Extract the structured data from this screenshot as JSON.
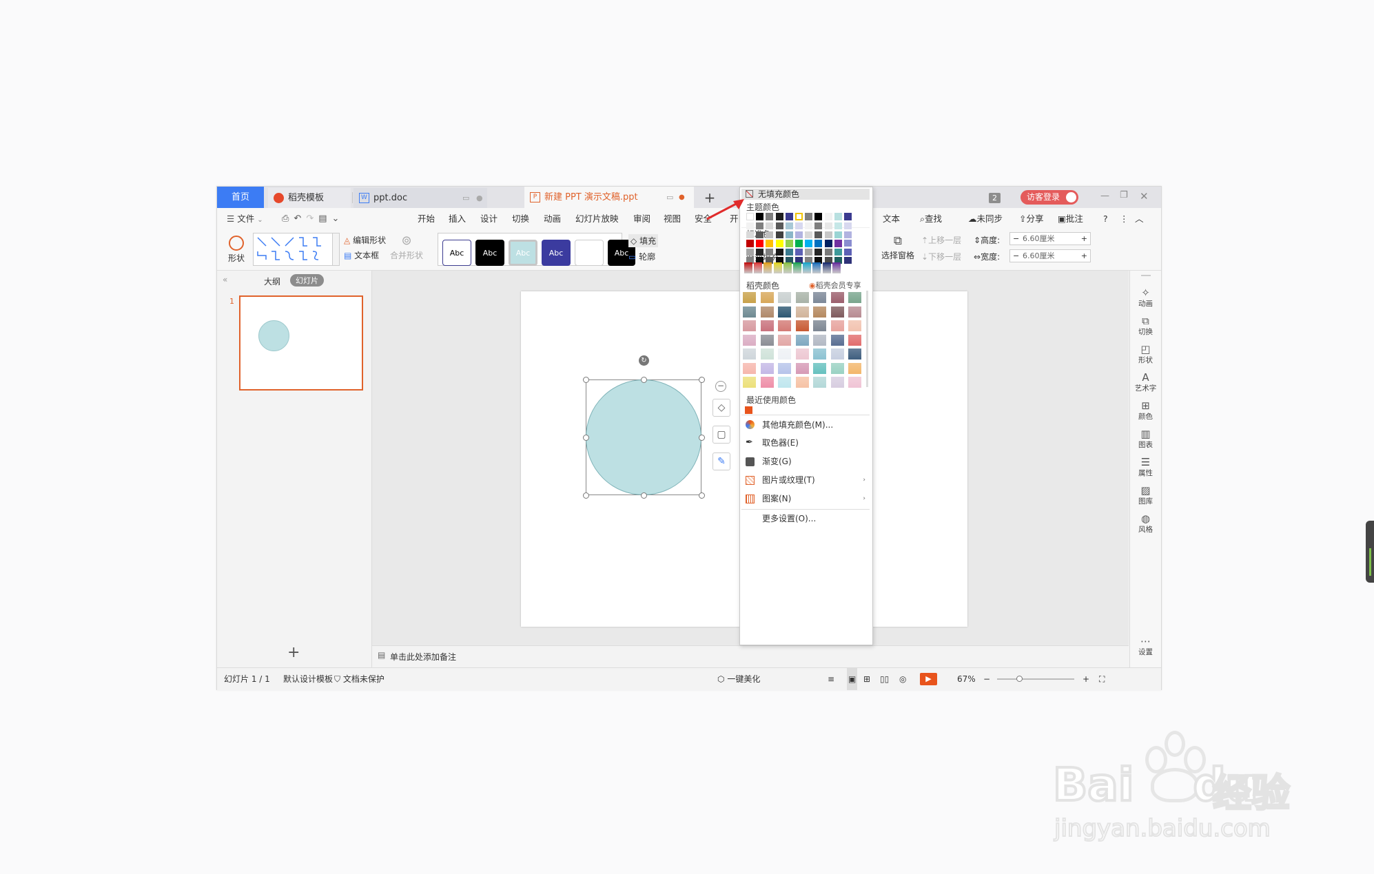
{
  "tabs": {
    "home": "首页",
    "template": "稻壳模板",
    "doc": "ppt.doc",
    "ppt": "新建 PPT 演示文稿.ppt",
    "add": "+"
  },
  "title_right": {
    "page_count": "2",
    "login": "访客登录"
  },
  "menu": {
    "file": "文件",
    "items": [
      "开始",
      "插入",
      "设计",
      "切换",
      "动画",
      "幻灯片放映",
      "审阅",
      "视图",
      "安全",
      "开"
    ],
    "text_tool": "文本",
    "find": "查找",
    "sync": "未同步",
    "share": "分享",
    "annotate": "批注",
    "help": "?"
  },
  "ribbon": {
    "shape": "形状",
    "edit_shape": "编辑形状",
    "textbox": "文本框",
    "merge_shape": "合并形状",
    "style_label": "Abc",
    "fill": "填充",
    "outline": "轮廓",
    "selection_pane": "选择窗格",
    "move_up": "上移一层",
    "move_down": "下移一层",
    "height_label": "高度:",
    "width_label": "宽度:",
    "height_value": "6.60厘米",
    "width_value": "6.60厘米"
  },
  "left_panel": {
    "outline_tab": "大纲",
    "slides_tab": "幻灯片",
    "slide_number": "1",
    "add": "+"
  },
  "notes_placeholder": "单击此处添加备注",
  "right_bar": [
    "动画",
    "切换",
    "形状",
    "艺术字",
    "颜色",
    "图表",
    "属性",
    "图库",
    "风格",
    "设置"
  ],
  "status": {
    "slide_info": "幻灯片 1 / 1",
    "template": "默认设计模板",
    "protection": "文档未保护",
    "beautify": "一键美化",
    "zoom": "67%"
  },
  "dropdown": {
    "no_fill": "无填充颜色",
    "theme_colors": "主题颜色",
    "standard_colors": "标准色",
    "gradient_fill": "渐变填充",
    "docer_colors": "稻壳颜色",
    "member_only": "稻壳会员专享",
    "recent_colors": "最近使用颜色",
    "more_fill": "其他填充颜色(M)...",
    "eyedropper": "取色器(E)",
    "gradient": "渐变(G)",
    "picture_texture": "图片或纹理(T)",
    "pattern": "图案(N)",
    "more_settings": "更多设置(O)...",
    "theme_top": [
      "#ffffff",
      "#000000",
      "#7f7f7f",
      "#1f1f1f",
      "#3b3b8f",
      "#ffffff",
      "#7f7f7f",
      "#000000",
      "#f2f2f2",
      "#b8e0e0",
      "#3b3b8f"
    ],
    "theme_cols": [
      [
        "#f2f2f2",
        "#d9d9d9",
        "#bfbfbf",
        "#a6a6a6",
        "#808080"
      ],
      [
        "#7f7f7f",
        "#595959",
        "#3f3f3f",
        "#262626",
        "#0d0d0d"
      ],
      [
        "#d9d9d9",
        "#bfbfbf",
        "#a6a6a6",
        "#808080",
        "#595959"
      ],
      [
        "#595959",
        "#404040",
        "#262626",
        "#1a1a1a",
        "#0d0d0d"
      ],
      [
        "#a8c8d6",
        "#8ab6c8",
        "#5d9bb0",
        "#3a7a8f",
        "#25545f"
      ],
      [
        "#d7d8ef",
        "#b1b3e0",
        "#8a8dd0",
        "#5d60b5",
        "#2f3278"
      ],
      [
        "#f2f2f2",
        "#d9d9d9",
        "#bfbfbf",
        "#a6a6a6",
        "#808080"
      ],
      [
        "#7f7f7f",
        "#595959",
        "#3f3f3f",
        "#262626",
        "#0d0d0d"
      ],
      [
        "#e8e8e8",
        "#c7c7c7",
        "#a3a3a3",
        "#7a7a7a",
        "#4a4a4a"
      ],
      [
        "#c5e7e7",
        "#9ad4d4",
        "#6ec1c1",
        "#3e9a9a",
        "#1f5f5f"
      ],
      [
        "#d7d8ef",
        "#b1b3e0",
        "#8a8dd0",
        "#5d60b5",
        "#2f3278"
      ]
    ],
    "standard": [
      "#c00000",
      "#ff0000",
      "#ffc000",
      "#ffff00",
      "#92d050",
      "#00b050",
      "#00b0f0",
      "#0070c0",
      "#002060",
      "#7030a0"
    ],
    "gradient_swatches": [
      "#c40d0d",
      "#e23a3a",
      "#e5a21b",
      "#e6d81e",
      "#8dc441",
      "#22a954",
      "#19a9cf",
      "#1a6fbf",
      "#1b2d72",
      "#6b2ea0"
    ],
    "docer": [
      [
        "#c9a24a",
        "#d8a85a",
        "#c8cfcf",
        "#a9b3a8",
        "#7d8898",
        "#9c5f6d",
        "#7aa68e"
      ],
      [
        "#6e8a92",
        "#b0896a",
        "#2c5772",
        "#d1b49b",
        "#b5895f",
        "#7f5a5d",
        "#b78b92"
      ],
      [
        "#d79aa0",
        "#c9727d",
        "#d47b76",
        "#c85a33",
        "#7d8793",
        "#e7a49e",
        "#f2c3b0"
      ],
      [
        "#dbaec4",
        "#8c8e95",
        "#e2a7a6",
        "#7fa8c0",
        "#b3b9c4",
        "#5b6f93",
        "#e26e6e"
      ],
      [
        "#cfd6db",
        "#cfe2d9",
        "#eef1f5",
        "#edc7d2",
        "#8cc2d2",
        "#c7cfe0",
        "#3f5e7f"
      ],
      [
        "#f6b7ad",
        "#c4b8e6",
        "#b7c4ea",
        "#d69ab6",
        "#66c1bf",
        "#9ad2c3",
        "#f3b76c"
      ],
      [
        "#ece07a",
        "#ee8fa8",
        "#bfe6ee",
        "#f6c2a5",
        "#b3d8d8",
        "#d7cde0",
        "#f0c4d5"
      ]
    ],
    "recent": [
      "#e8541c"
    ]
  },
  "watermark": {
    "brand": "Bai",
    "brand2": "du",
    "cn": "经验",
    "url": "jingyan.baidu.com"
  },
  "colors": {
    "accent_blue": "#3c7cf4",
    "accent_orange": "#e0622b",
    "circle_fill": "#bde0e3",
    "login_bg": "#e45b5b"
  }
}
